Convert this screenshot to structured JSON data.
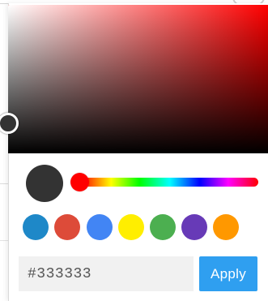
{
  "picker": {
    "current_color": "#333333",
    "hue_color": "#ff0000",
    "hex_value": "#333333",
    "apply_label": "Apply",
    "accent_color": "#2f9ff0"
  },
  "presets": [
    {
      "name": "swatch-blue",
      "color": "#1e88c8"
    },
    {
      "name": "swatch-red",
      "color": "#dd4b39"
    },
    {
      "name": "swatch-light-blue",
      "color": "#4285f4"
    },
    {
      "name": "swatch-yellow",
      "color": "#ffee00"
    },
    {
      "name": "swatch-green",
      "color": "#4caf50"
    },
    {
      "name": "swatch-purple",
      "color": "#673ab7"
    },
    {
      "name": "swatch-orange",
      "color": "#ff9800"
    }
  ]
}
